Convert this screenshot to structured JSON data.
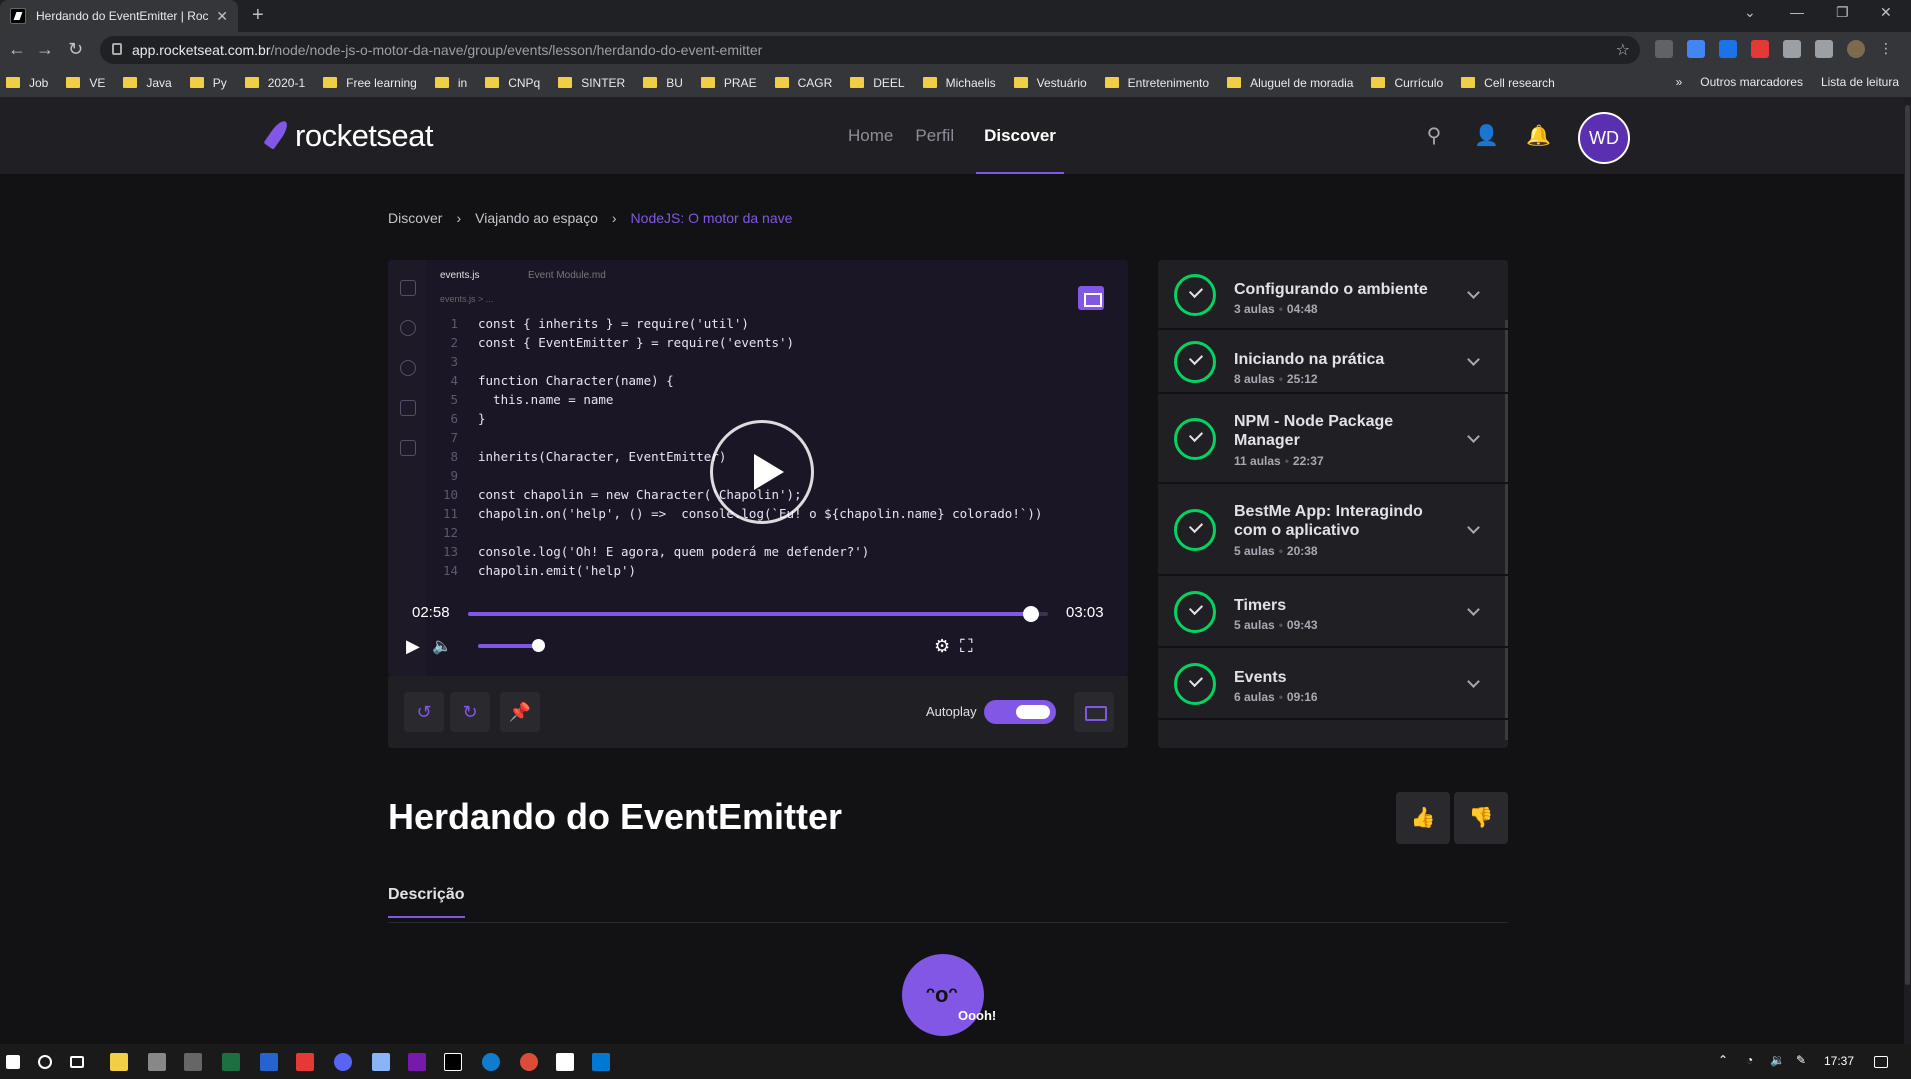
{
  "browser": {
    "tab_title": "Herdando do EventEmitter | Roc",
    "url_host": "app.rocketseat.com.br",
    "url_path": "/node/node-js-o-motor-da-nave/group/events/lesson/herdando-do-event-emitter",
    "bookmarks": [
      "Job",
      "VE",
      "Java",
      "Py",
      "2020-1",
      "Free learning",
      "in",
      "CNPq",
      "SINTER",
      "BU",
      "PRAE",
      "CAGR",
      "DEEL",
      "Michaelis",
      "Vestuário",
      "Entretenimento",
      "Aluguel de moradia",
      "Currículo",
      "Cell research"
    ],
    "bookmarks_more": "»",
    "other_bookmarks": "Outros marcadores",
    "reading_list": "Lista de leitura"
  },
  "header": {
    "logo_text": "rocketseat",
    "nav": [
      "Home",
      "Perfil",
      "Discover"
    ],
    "avatar_initials": "WD"
  },
  "breadcrumb": [
    "Discover",
    "Viajando ao espaço",
    "NodeJS: O motor da nave"
  ],
  "player": {
    "editor_tabs": [
      "events.js",
      "Event Module.md"
    ],
    "editor_path": "events.js > ...",
    "code_lines": [
      "const { inherits } = require('util')",
      "const { EventEmitter } = require('events')",
      "",
      "function Character(name) {",
      "  this.name = name",
      "}",
      "",
      "inherits(Character, EventEmitter)",
      "",
      "const chapolin = new Character('Chapolin');",
      "chapolin.on('help', () =>  console.log(`Eu! o ${chapolin.name} colorado!`))",
      "",
      "console.log('Oh! E agora, quem poderá me defender?')",
      "chapolin.emit('help')"
    ],
    "current_time": "02:58",
    "duration": "03:03",
    "progress_fraction": 0.97,
    "volume_fraction": 0.8,
    "autoplay_label": "Autoplay"
  },
  "modules": [
    {
      "title": "Configurando o ambiente",
      "lessons": "3 aulas",
      "duration": "04:48"
    },
    {
      "title": "Iniciando na prática",
      "lessons": "8 aulas",
      "duration": "25:12"
    },
    {
      "title": "NPM - Node Package Manager",
      "lessons": "11 aulas",
      "duration": "22:37"
    },
    {
      "title": "BestMe App: Interagindo com o aplicativo",
      "lessons": "5 aulas",
      "duration": "20:38"
    },
    {
      "title": "Timers",
      "lessons": "5 aulas",
      "duration": "09:43"
    },
    {
      "title": "Events",
      "lessons": "6 aulas",
      "duration": "09:16"
    }
  ],
  "lesson": {
    "title": "Herdando do EventEmitter",
    "tab_description": "Descrição",
    "mascot_text": "Oooh!"
  },
  "taskbar": {
    "time": "17:37"
  },
  "colors": {
    "accent": "#8257e5",
    "success": "#04d361",
    "background": "#121214",
    "surface": "#202024"
  }
}
